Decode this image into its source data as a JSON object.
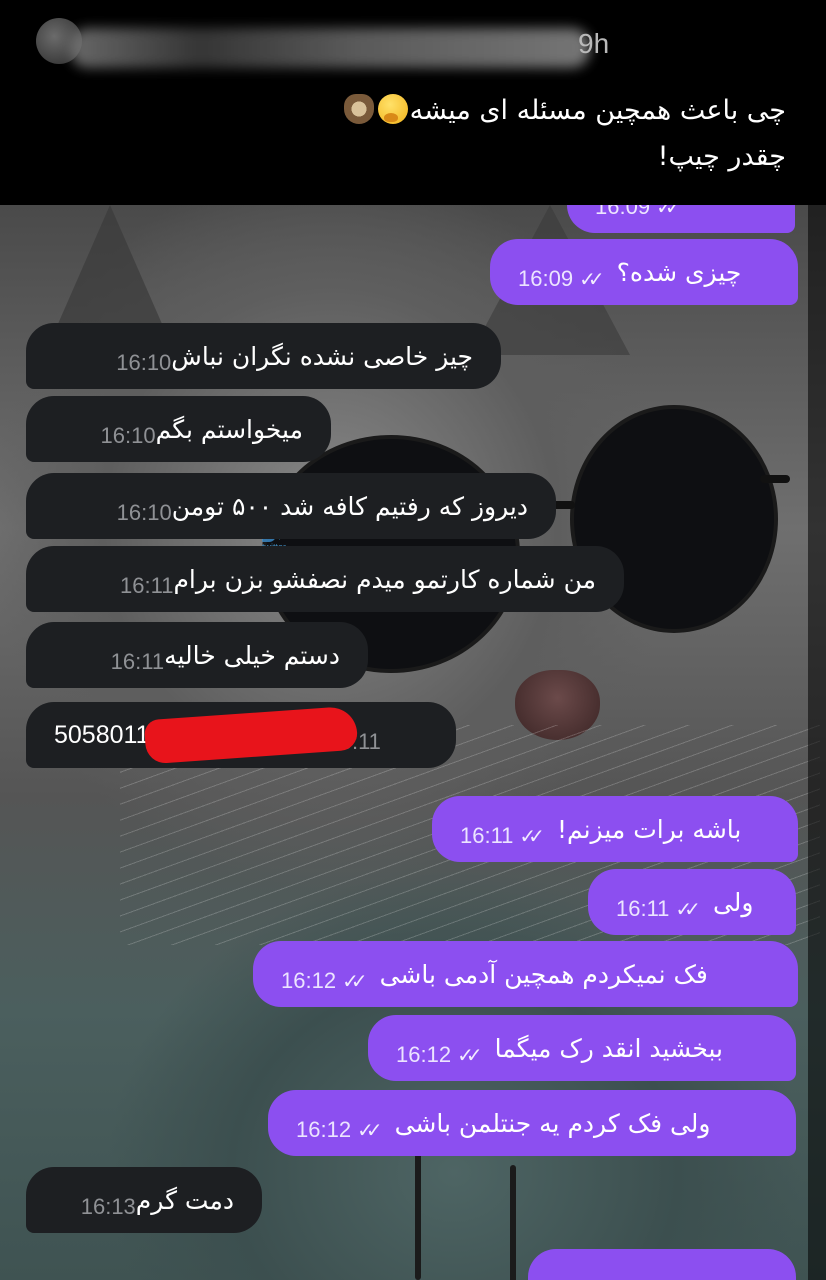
{
  "tweet": {
    "time_ago": "9h",
    "line1": "چی باعث همچین مسئله ای میشه",
    "line2": "چقدر چیپ!",
    "emojis": [
      "thinking-face-icon",
      "sloth-icon"
    ]
  },
  "chat": {
    "watermark": [
      "persian",
      "twitter"
    ],
    "messages": [
      {
        "dir": "out",
        "text": "",
        "time": "16:09",
        "ticks": "✓✓"
      },
      {
        "dir": "out",
        "text": "چیزی شده؟",
        "time": "16:09",
        "ticks": "✓✓"
      },
      {
        "dir": "in",
        "text": "چیز خاصی نشده نگران نباش",
        "time": "16:10"
      },
      {
        "dir": "in",
        "text": "میخواستم بگم",
        "time": "16:10"
      },
      {
        "dir": "in",
        "text": "دیروز که رفتیم کافه شد ۵۰۰ تومن",
        "time": "16:10"
      },
      {
        "dir": "in",
        "text": "من شماره کارتمو میدم نصفشو بزن برام",
        "time": "16:11"
      },
      {
        "dir": "in",
        "text": "دستم خیلی خالیه",
        "time": "16:11"
      },
      {
        "dir": "in",
        "text": "5058011",
        "time": "16:11",
        "redacted": true
      },
      {
        "dir": "out",
        "text": "باشه برات میزنم!",
        "time": "16:11",
        "ticks": "✓✓"
      },
      {
        "dir": "out",
        "text": "ولی",
        "time": "16:11",
        "ticks": "✓✓"
      },
      {
        "dir": "out",
        "text": "فک نمیکردم همچین آدمی باشی",
        "time": "16:12",
        "ticks": "✓✓"
      },
      {
        "dir": "out",
        "text": "ببخشید انقد رک میگما",
        "time": "16:12",
        "ticks": "✓✓"
      },
      {
        "dir": "out",
        "text": "ولی فک کردم یه جنتلمن باشی",
        "time": "16:12",
        "ticks": "✓✓"
      },
      {
        "dir": "in",
        "text": "دمت گرم",
        "time": "16:13"
      },
      {
        "dir": "out",
        "text": "",
        "time": "",
        "ticks": ""
      }
    ]
  },
  "colors": {
    "incoming_bubble": "#1d1f22",
    "outgoing_bubble": "#8c4ff0",
    "redaction": "#e8141b"
  }
}
